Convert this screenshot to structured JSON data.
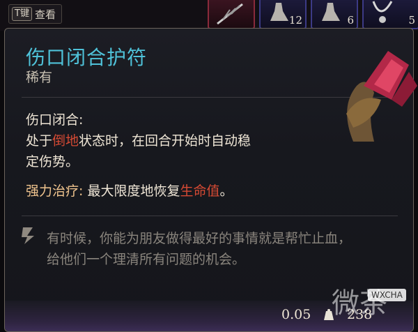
{
  "topbar": {
    "key_cap": "T键",
    "view_label": "查看",
    "slots": [
      {
        "count": ""
      },
      {
        "count": "12"
      },
      {
        "count": "6"
      },
      {
        "count": "5"
      }
    ]
  },
  "item": {
    "name": "伤口闭合护符",
    "rarity": "稀有",
    "effect_title": "伤口闭合:",
    "effect_line1_a": "处于",
    "effect_line1_hl": "倒地",
    "effect_line1_b": "状态时，在回合开始时自动稳",
    "effect_line2": "定伤势。",
    "heal_label": "强力治疗:",
    "heal_text": " 最大限度地恢复",
    "heal_hl": "生命值",
    "heal_end": "。",
    "quote_line1": "有时候，你能为朋友做得最好的事情就是帮忙止血，",
    "quote_line2": "给他们一个理清所有问题的机会。",
    "weight": "0.05",
    "gold": "238"
  },
  "watermark": {
    "text": "微茶",
    "badge": "WXCHA"
  },
  "colors": {
    "title": "#4fc2d9",
    "highlight": "#d64a34",
    "heal_label": "#f0c48e"
  }
}
